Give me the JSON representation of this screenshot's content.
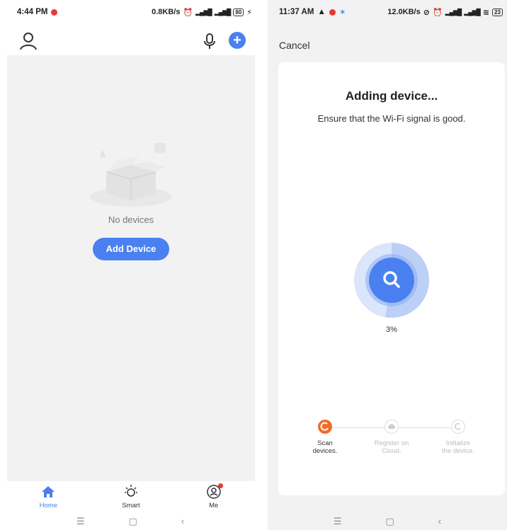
{
  "left": {
    "status": {
      "time": "4:44 PM",
      "speed": "0.8KB/s",
      "battery": "80"
    },
    "empty_text": "No devices",
    "add_device_label": "Add Device",
    "tabs": [
      {
        "label": "Home",
        "icon": "home-icon",
        "active": true
      },
      {
        "label": "Smart",
        "icon": "sun-icon",
        "active": false
      },
      {
        "label": "Me",
        "icon": "me-icon",
        "active": false
      }
    ]
  },
  "right": {
    "status": {
      "time": "11:37 AM",
      "speed": "12.0KB/s",
      "battery": "23"
    },
    "cancel_label": "Cancel",
    "title": "Adding device...",
    "subtitle": "Ensure that the Wi-Fi signal is good.",
    "progress_percent": 3,
    "progress_label": "3%",
    "steps": [
      {
        "label_line1": "Scan",
        "label_line2": "devices.",
        "active": true
      },
      {
        "label_line1": "Register on",
        "label_line2": "Cloud.",
        "active": false
      },
      {
        "label_line1": "Initialize",
        "label_line2": "the device.",
        "active": false
      }
    ]
  },
  "colors": {
    "accent": "#4a80f0",
    "orange": "#f26b2a",
    "background": "#f2f2f2"
  }
}
